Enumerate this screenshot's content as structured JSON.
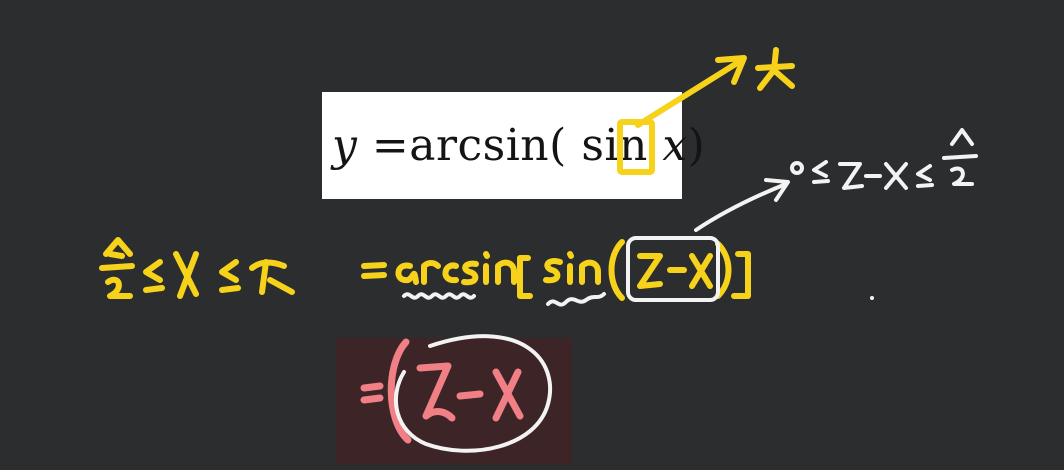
{
  "formula": {
    "y": "y",
    "eq": "=",
    "func": "arcsin",
    "lparen": "(",
    "inner": "sin",
    "x": "x",
    "rparen": ")"
  },
  "colors": {
    "background": "#2b2d2f",
    "yellow_ink": "#f6d21b",
    "white_ink": "#f3f3f3",
    "pink_ink": "#f07f86",
    "panel": "#3d2427"
  }
}
